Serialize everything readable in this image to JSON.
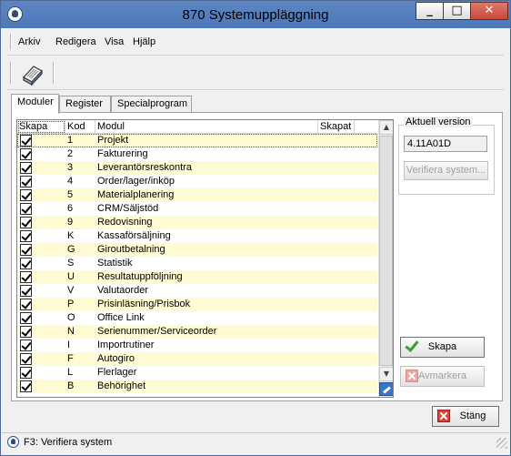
{
  "window": {
    "title": "870 Systemuppläggning",
    "minimize": "_",
    "maximize": "□",
    "close": "✕"
  },
  "menu": [
    "Arkiv",
    "Redigera",
    "Visa",
    "Hjälp"
  ],
  "toolbar": {
    "icon": "book-icon"
  },
  "tabs": [
    "Moduler",
    "Register",
    "Specialprogram"
  ],
  "grid": {
    "headers": {
      "skapa": "Skapa",
      "kod": "Kod",
      "modul": "Modul",
      "skapat": "Skapat"
    },
    "rows": [
      {
        "kod": "1",
        "modul": "Projekt",
        "checked": true
      },
      {
        "kod": "2",
        "modul": "Fakturering",
        "checked": true
      },
      {
        "kod": "3",
        "modul": "Leverantörsreskontra",
        "checked": true
      },
      {
        "kod": "4",
        "modul": "Order/lager/inköp",
        "checked": true
      },
      {
        "kod": "5",
        "modul": "Materialplanering",
        "checked": true
      },
      {
        "kod": "6",
        "modul": "CRM/Säljstöd",
        "checked": true
      },
      {
        "kod": "9",
        "modul": "Redovisning",
        "checked": true
      },
      {
        "kod": "K",
        "modul": "Kassaförsäljning",
        "checked": true
      },
      {
        "kod": "G",
        "modul": "Giroutbetalning",
        "checked": true
      },
      {
        "kod": "S",
        "modul": "Statistik",
        "checked": true
      },
      {
        "kod": "U",
        "modul": "Resultatuppföljning",
        "checked": true
      },
      {
        "kod": "V",
        "modul": "Valutaorder",
        "checked": true
      },
      {
        "kod": "P",
        "modul": "Prisinläsning/Prisbok",
        "checked": true
      },
      {
        "kod": "O",
        "modul": "Office Link",
        "checked": true
      },
      {
        "kod": "N",
        "modul": "Serienummer/Serviceorder",
        "checked": true
      },
      {
        "kod": "I",
        "modul": "Importrutiner",
        "checked": true
      },
      {
        "kod": "F",
        "modul": "Autogiro",
        "checked": true
      },
      {
        "kod": "L",
        "modul": "Flerlager",
        "checked": true
      },
      {
        "kod": "B",
        "modul": "Behörighet",
        "checked": true
      }
    ],
    "scroll_up": "▲",
    "scroll_down": "▼"
  },
  "version": {
    "label": "Aktuell version",
    "value": "4.11A01D",
    "verify_button": "Verifiera system..."
  },
  "buttons": {
    "skapa": "Skapa",
    "avmarkera": "Avmarkera",
    "stang": "Stäng"
  },
  "status": {
    "text": "F3: Verifiera system"
  }
}
